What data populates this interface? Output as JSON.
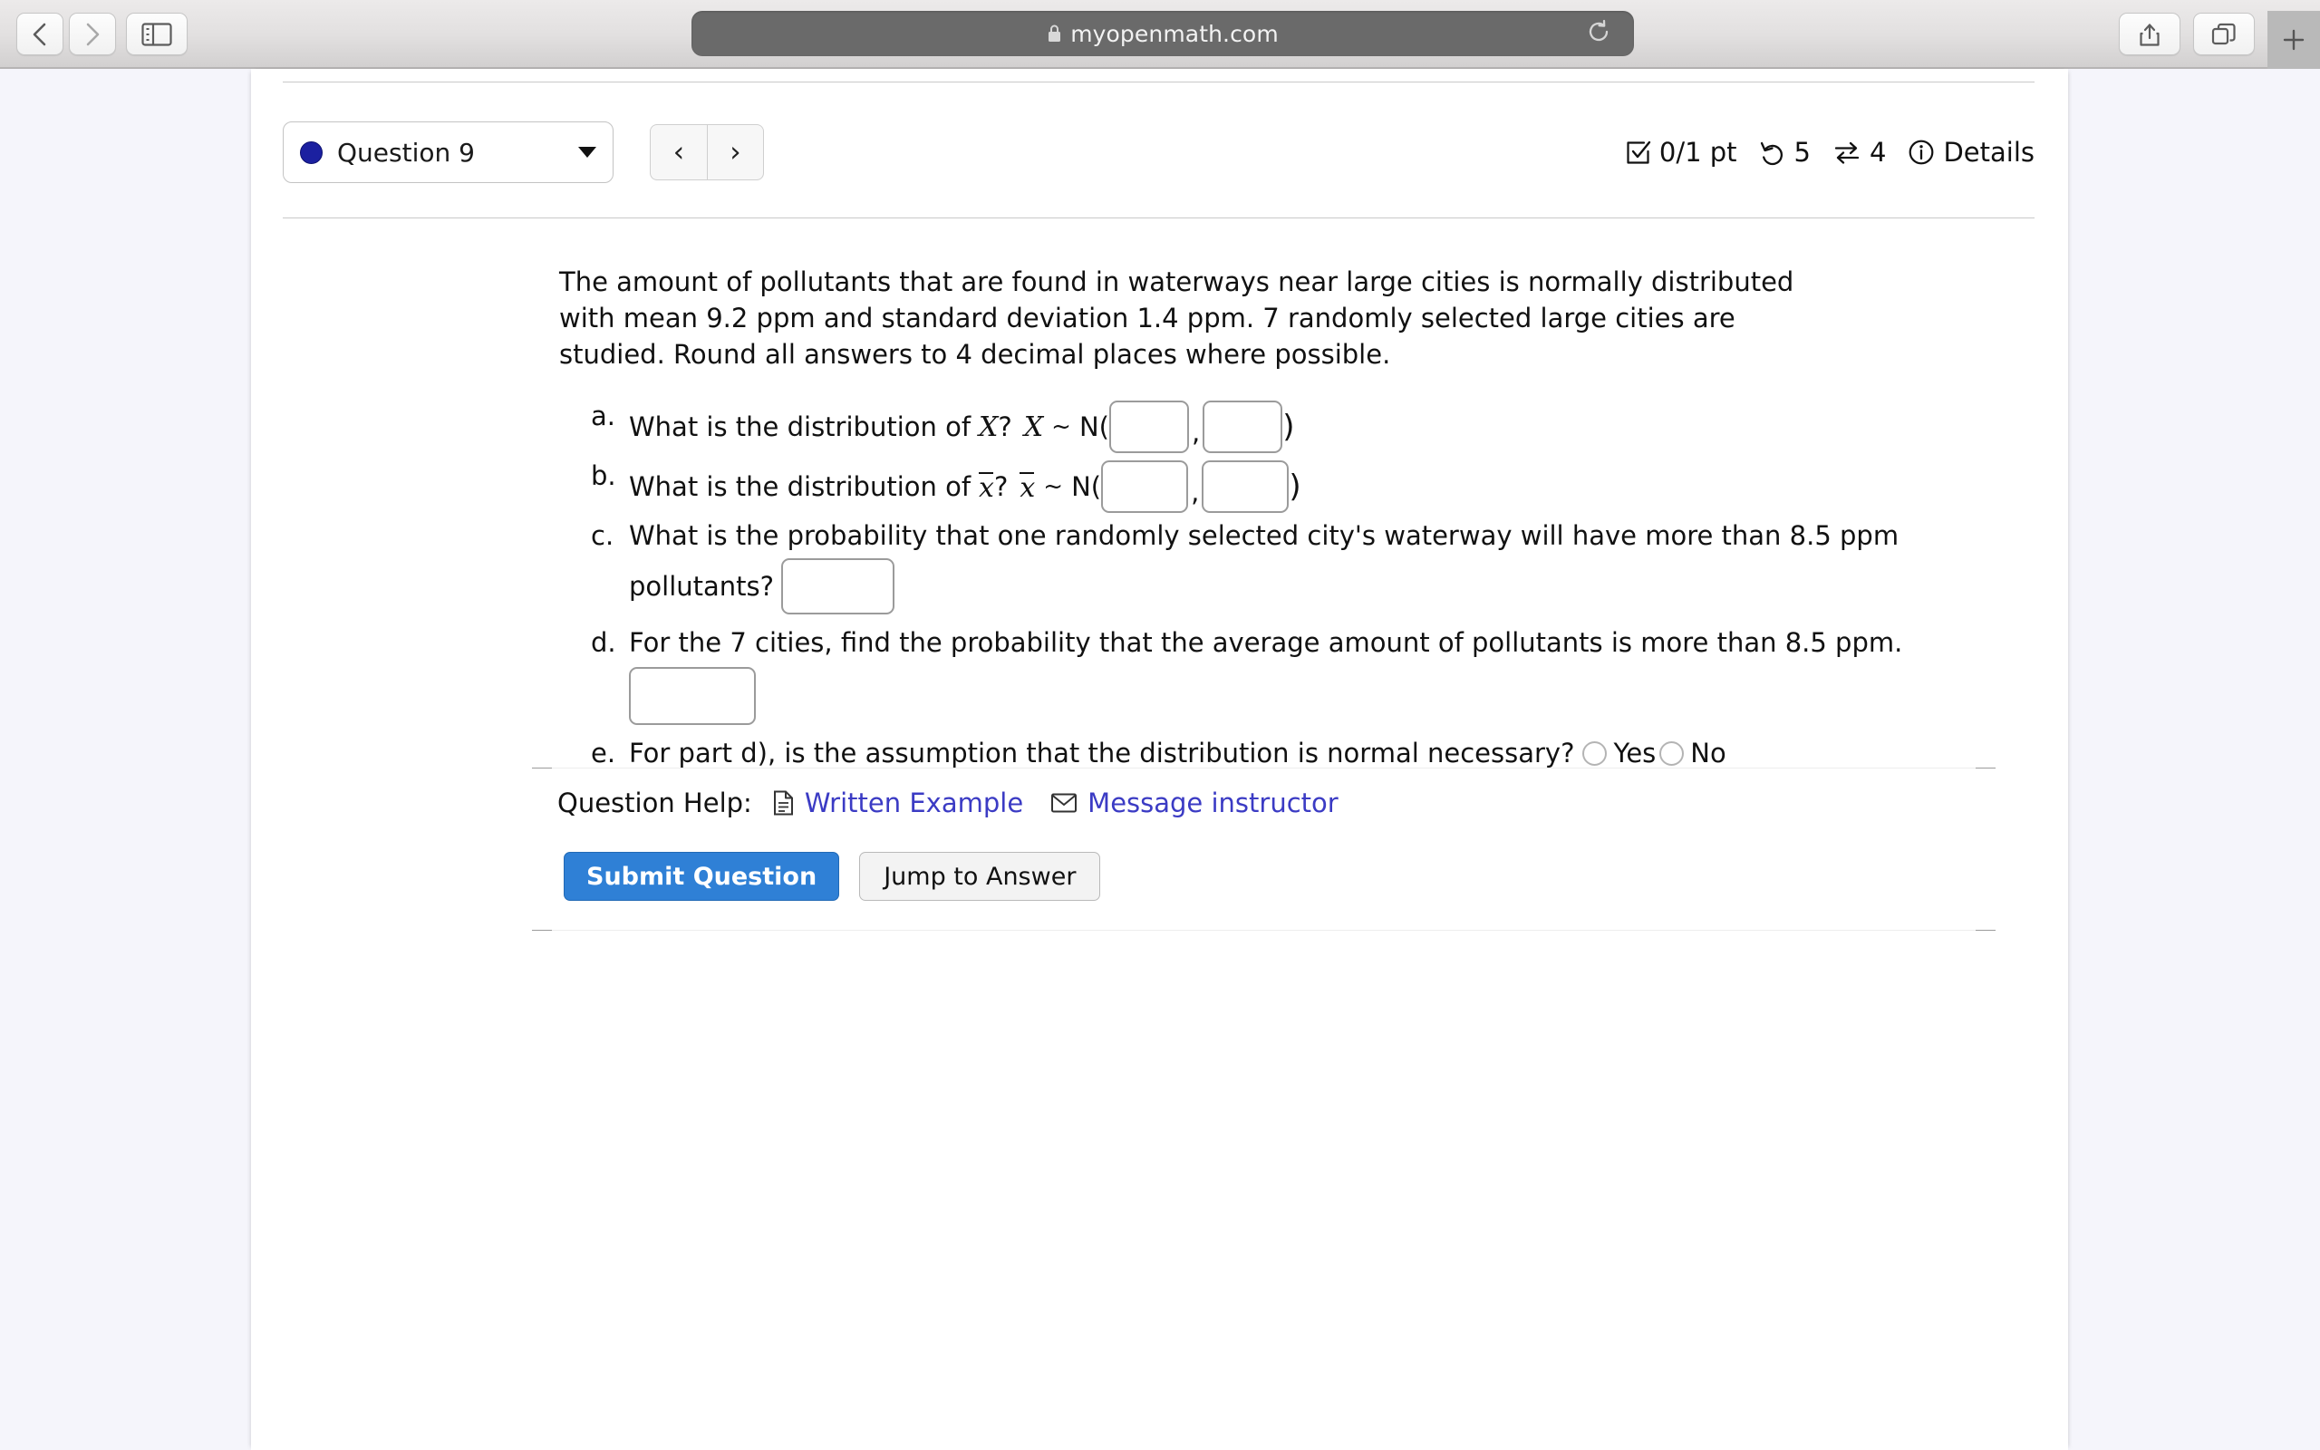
{
  "browser": {
    "back_icon": "chevron-left-icon",
    "forward_icon": "chevron-right-icon",
    "sidebar_icon": "sidebar-toggle-icon",
    "lock_icon": "lock-icon",
    "url": "myopenmath.com",
    "reload_icon": "reload-icon",
    "share_icon": "share-icon",
    "tabs_icon": "tabs-overview-icon",
    "new_tab_label": "+"
  },
  "question_header": {
    "status_dot_color": "#1b20a0",
    "selected_question": "Question 9",
    "caret_icon": "chevron-down-icon",
    "prev_label": "‹",
    "next_label": "›",
    "meta": {
      "score_icon": "checkbox-checked-icon",
      "score": "0/1 pt",
      "attempts_icon": "undo-arrow-icon",
      "attempts": "5",
      "versions_icon": "swap-arrows-icon",
      "versions": "4",
      "info_icon": "info-circle-icon",
      "details_label": "Details"
    }
  },
  "problem": {
    "text": "The amount of pollutants that are found in waterways near large cities is normally distributed with mean 9.2 ppm and standard deviation 1.4 ppm. 7 randomly selected large cities are studied. Round all answers to 4 decimal places where possible."
  },
  "parts": {
    "a": {
      "marker": "a.",
      "prompt": "What is the distribution of",
      "var": "X",
      "question_mark": "?",
      "var_repeat": "X",
      "tilde": "~",
      "dist": "N(",
      "comma": ",",
      "close_paren": ")",
      "mean_value": "",
      "sd_value": ""
    },
    "b": {
      "marker": "b.",
      "prompt": "What is the distribution of",
      "var": "x",
      "question_mark": "?",
      "var_repeat": "x",
      "tilde": "~",
      "dist": "N(",
      "comma": ",",
      "close_paren": ")",
      "mean_value": "",
      "sd_value": ""
    },
    "c": {
      "marker": "c.",
      "line1": "What is the probability that one randomly selected city's waterway will have more than 8.5 ppm",
      "line2": "pollutants?",
      "value": ""
    },
    "d": {
      "marker": "d.",
      "text": "For the 7 cities, find the probability that the average amount of pollutants is more than 8.5 ppm.",
      "value": ""
    },
    "e": {
      "marker": "e.",
      "text": "For part d), is the assumption that the distribution is normal necessary?",
      "yes_label": "Yes",
      "no_label": "No"
    }
  },
  "help": {
    "label": "Question Help:",
    "written_example_icon": "document-icon",
    "written_example": "Written Example",
    "message_icon": "envelope-icon",
    "message_instructor": "Message instructor",
    "link_color": "#3b3bc4"
  },
  "actions": {
    "submit_label": "Submit Question",
    "submit_color": "#2f80d6",
    "jump_label": "Jump to Answer"
  }
}
